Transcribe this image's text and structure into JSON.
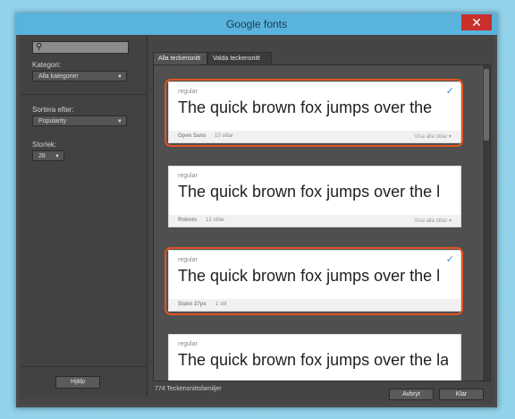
{
  "window": {
    "title": "Google fonts",
    "close_glyph": "✕"
  },
  "sidebar": {
    "search_icon": "search-icon",
    "category_label": "Kategori:",
    "category_value": "Alla kategorier",
    "sort_label": "Sortera efter:",
    "sort_value": "Popularity",
    "size_label": "Storlek:",
    "size_value": "28",
    "help_button": "Hjälp"
  },
  "tabs": [
    {
      "label": "Alla teckensnitt",
      "active": true
    },
    {
      "label": "Valda teckensnitt",
      "active": false
    }
  ],
  "fonts": [
    {
      "style": "regular",
      "sample": "The quick brown fox jumps over the",
      "family": "Open Sans",
      "count": "10 stilar",
      "show_all": "Visa alla stilar",
      "selected": true
    },
    {
      "style": "regular",
      "sample": "The quick brown fox jumps over the l",
      "family": "Roboto",
      "count": "12 stilar",
      "show_all": "Visa alla stilar",
      "selected": false
    },
    {
      "style": "regular",
      "sample": "The quick brown fox jumps over the l",
      "family": "Slabo 27px",
      "count": "1 stil",
      "show_all": "",
      "selected": true
    },
    {
      "style": "regular",
      "sample": "The quick brown fox jumps over the la",
      "family": "",
      "count": "",
      "show_all": "",
      "selected": false
    }
  ],
  "footer": {
    "family_count": "774 Teckensnittsfamiljer",
    "cancel_button": "Avbryt",
    "ok_button": "Klar"
  },
  "colors": {
    "selection_ring": "#e35320",
    "check": "#3b8fd6",
    "titlebar": "#59b3dc",
    "close": "#c9302c"
  }
}
